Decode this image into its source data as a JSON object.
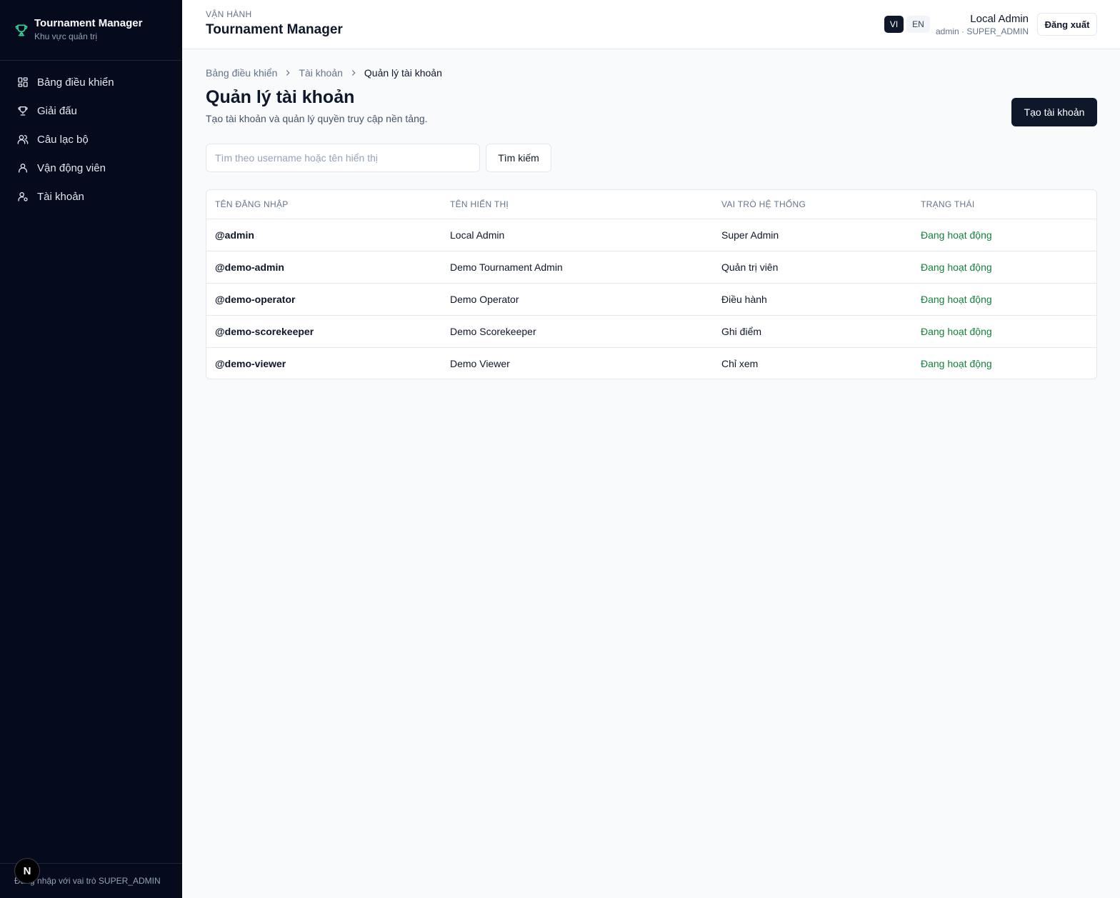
{
  "brand": {
    "title": "Tournament Manager",
    "subtitle": "Khu vực quản trị",
    "icon": "trophy-icon",
    "accent": "#34d399"
  },
  "sidebar": {
    "items": [
      {
        "label": "Bảng điều khiển",
        "icon": "dashboard-icon"
      },
      {
        "label": "Giải đấu",
        "icon": "trophy-icon"
      },
      {
        "label": "Câu lạc bộ",
        "icon": "users-icon"
      },
      {
        "label": "Vận động viên",
        "icon": "user-icon"
      },
      {
        "label": "Tài khoản",
        "icon": "user-cog-icon"
      }
    ],
    "footer": "Đăng nhập với vai trò SUPER_ADMIN",
    "badge": "N"
  },
  "topbar": {
    "eyebrow": "VẬN HÀNH",
    "title": "Tournament Manager",
    "lang_vi": "VI",
    "lang_en": "EN",
    "user_name": "Local Admin",
    "user_meta": "admin · SUPER_ADMIN",
    "logout": "Đăng xuất"
  },
  "breadcrumb": [
    "Bảng điều khiển",
    "Tài khoản",
    "Quản lý tài khoản"
  ],
  "page": {
    "title": "Quản lý tài khoản",
    "description": "Tạo tài khoản và quản lý quyền truy cập nền tảng.",
    "create_button": "Tạo tài khoản"
  },
  "search": {
    "placeholder": "Tìm theo username hoặc tên hiển thị",
    "value": "",
    "button": "Tìm kiếm"
  },
  "table": {
    "headers": [
      "Tên đăng nhập",
      "Tên hiển thị",
      "Vai trò hệ thống",
      "Trạng thái"
    ],
    "rows": [
      {
        "username": "@admin",
        "display": "Local Admin",
        "role": "Super Admin",
        "status": "Đang hoạt động"
      },
      {
        "username": "@demo-admin",
        "display": "Demo Tournament Admin",
        "role": "Quản trị viên",
        "status": "Đang hoạt động"
      },
      {
        "username": "@demo-operator",
        "display": "Demo Operator",
        "role": "Điều hành",
        "status": "Đang hoạt động"
      },
      {
        "username": "@demo-scorekeeper",
        "display": "Demo Scorekeeper",
        "role": "Ghi điểm",
        "status": "Đang hoạt động"
      },
      {
        "username": "@demo-viewer",
        "display": "Demo Viewer",
        "role": "Chỉ xem",
        "status": "Đang hoạt động"
      }
    ],
    "status_color": "#15803d"
  }
}
